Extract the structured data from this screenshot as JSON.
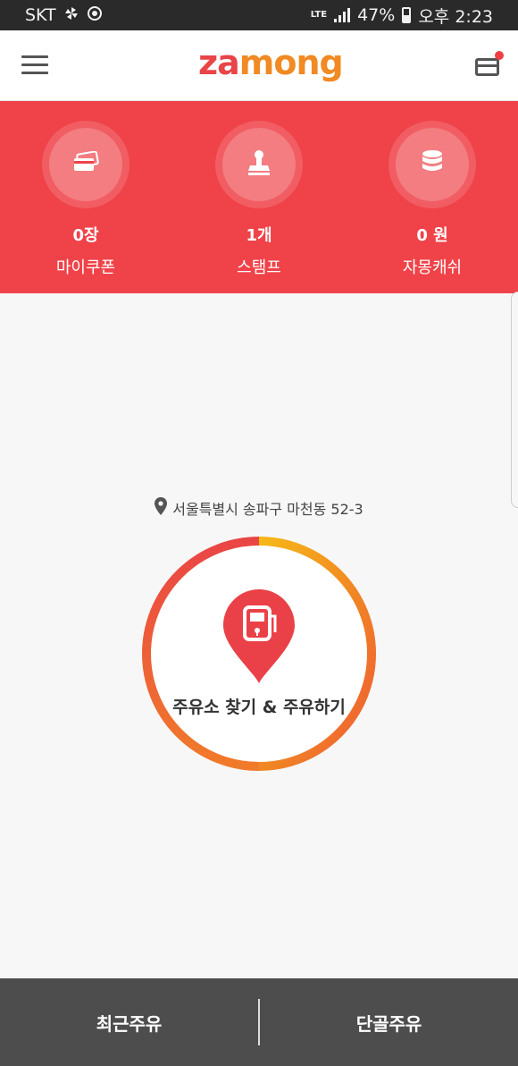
{
  "status_bar": {
    "carrier": "SKT",
    "network": "LTE",
    "battery": "47%",
    "time": "오후 2:23"
  },
  "header": {
    "logo_z": "za",
    "logo_rest": "mong"
  },
  "stats": [
    {
      "value": "0장",
      "label": "마이쿠폰",
      "icon": "coupon-icon"
    },
    {
      "value": "1개",
      "label": "스탬프",
      "icon": "stamp-icon"
    },
    {
      "value": "0 원",
      "label": "자몽캐쉬",
      "icon": "coins-icon"
    }
  ],
  "main": {
    "location": "서울특별시 송파구 마천동 52-3",
    "action_label": "주유소 찾기 & 주유하기"
  },
  "bottom_bar": {
    "left_label": "최근주유",
    "right_label": "단골주유"
  },
  "colors": {
    "accent_red": "#ef4349",
    "accent_orange": "#f18a23",
    "ring_yellow": "#f6b817",
    "bottom_bar": "#4d4d4d"
  }
}
